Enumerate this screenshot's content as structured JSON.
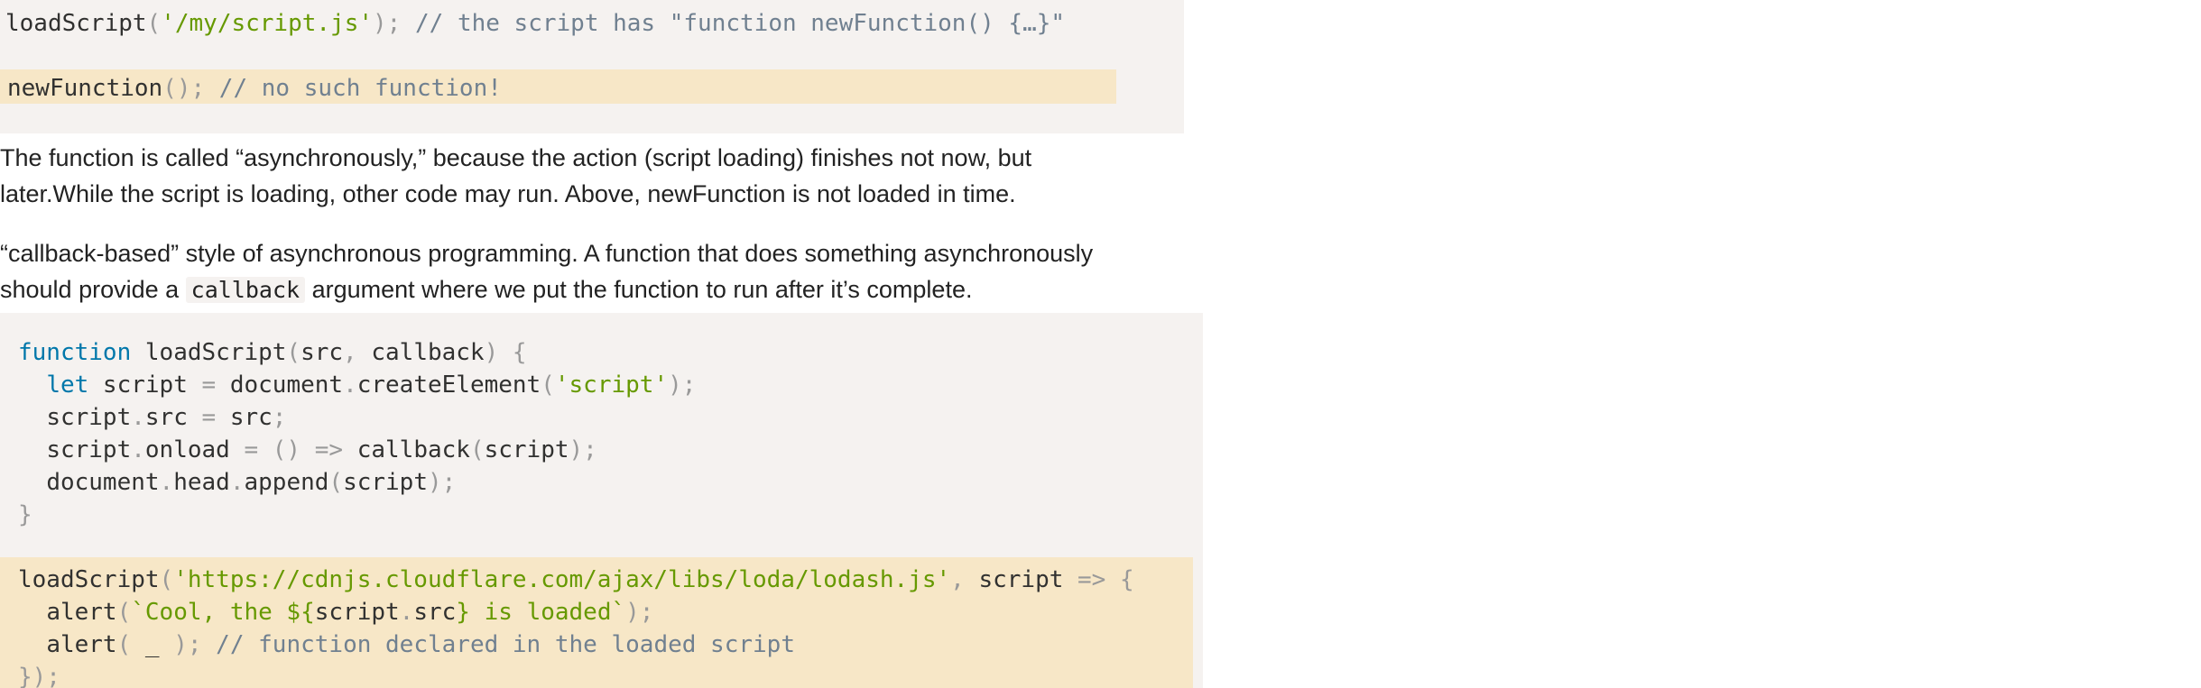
{
  "top_code": {
    "line1": {
      "fn": "loadScript",
      "open": "(",
      "arg": "'/my/script.js'",
      "close": ");",
      "comment": " // the script has \"function newFunction() {…}\""
    },
    "line2": {
      "fn": "newFunction",
      "punct": "();",
      "comment": " // no such function!"
    }
  },
  "prose": {
    "para1_line1": "The function is called “asynchronously,” because the action (script loading) finishes not now, but",
    "para1_line2": "later.While the script is loading,  other code may run. Above, newFunction is not loaded in time.",
    "para2_line1": " “callback-based” style of asynchronous programming. A function that does something asynchronously",
    "para2_line2_before": "should  provide a ",
    "para2_inline_code": "callback",
    "para2_line2_after": "  argument where we put the function to run after it’s complete."
  },
  "bottom_code": {
    "l1": {
      "kw": "function",
      "name": " loadScript",
      "p1": "(",
      "a1": "src",
      "p2": ",",
      "a2": " callback",
      "p3": ")",
      "p4": " {"
    },
    "l2": {
      "indent": "  ",
      "kw": "let",
      "v": " script ",
      "eq": "=",
      "obj": " document",
      "dot": ".",
      "m": "createElement",
      "p1": "(",
      "s": "'script'",
      "p2": ");"
    },
    "l3": {
      "indent": "  ",
      "o": "script",
      "dot": ".",
      "p": "src ",
      "eq": "=",
      "v": " src",
      "end": ";"
    },
    "l4": {
      "indent": "  ",
      "o": "script",
      "dot": ".",
      "p": "onload ",
      "arrow": "= () =>",
      "fn": " callback",
      "p1": "(",
      "a": "script",
      "p2": ");"
    },
    "l5": {
      "indent": "  ",
      "o": "document",
      "dot1": ".",
      "h": "head",
      "dot2": ".",
      "m": "append",
      "p1": "(",
      "a": "script",
      "p2": ");"
    },
    "l6": {
      "brace": "}"
    },
    "l7": {
      "fn": "loadScript",
      "p1": "(",
      "s": "'https://cdnjs.cloudflare.com/ajax/libs/loda/lodash.js'",
      "p2": ",",
      "a": " script",
      "arrow": " =>",
      "b": " {"
    },
    "l8": {
      "indent": "  ",
      "fn": "alert",
      "p1": "(",
      "t1": "`Cool, the ${",
      "e1": "script",
      "dot": ".",
      "e2": "src",
      "t2": "} is loaded`",
      "p2": ");"
    },
    "l9": {
      "indent": "  ",
      "fn": "alert",
      "p1": "(",
      "v": " _ ",
      "p2": ");",
      "c": " // function declared in the loaded script"
    },
    "l10": {
      "end": "});"
    }
  }
}
